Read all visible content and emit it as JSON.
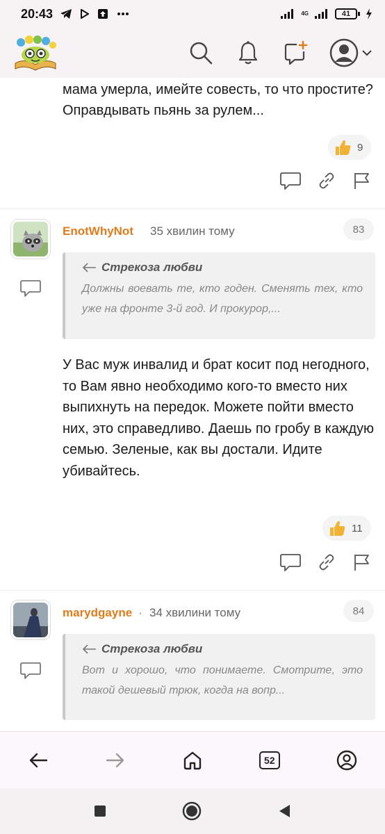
{
  "status_bar": {
    "time": "20:43",
    "network": "4G",
    "battery": "41"
  },
  "header": {
    "icons": [
      "search-icon",
      "bell-icon",
      "new-post-icon",
      "user-avatar-icon",
      "chevron-down-icon"
    ]
  },
  "top_comment": {
    "text": "мама умерла, имейте совесть, то что простите? Оправдывать пьянь за рулем...",
    "likes": "9"
  },
  "comments": [
    {
      "username": "EnotWhyNot",
      "time_ago": "35 хвилин тому",
      "number": "83",
      "quote_author": "Стрекоза любви",
      "quote_text": "Должны воевать те, кто годен. Сменять тех, кто уже на фронте 3-й год. И прокурор,...",
      "text": "У Вас муж инвалид и брат косит под негодного, то Вам явно необходимо кого-то вместо них выпихнуть на передок. Можете пойти вместо них, это справедливо. Даешь по гробу в каждую семью. Зеленые, как вы достали. Идите убивайтесь.",
      "likes": "11"
    },
    {
      "username": "marydgayne",
      "separator": "·",
      "time_ago": "34 хвилини тому",
      "number": "84",
      "quote_author": "Стрекоза любви",
      "quote_text": "Вот и хорошо, что понимаете. Смотрите, это такой дешевый трюк, когда на вопр..."
    }
  ],
  "browser_nav": {
    "tabs_count": "52"
  },
  "colors": {
    "accent": "#e07c1a",
    "header_bg": "#f7f3f5",
    "quote_bg": "#f1f1f1",
    "like_yellow": "#f2b233"
  }
}
